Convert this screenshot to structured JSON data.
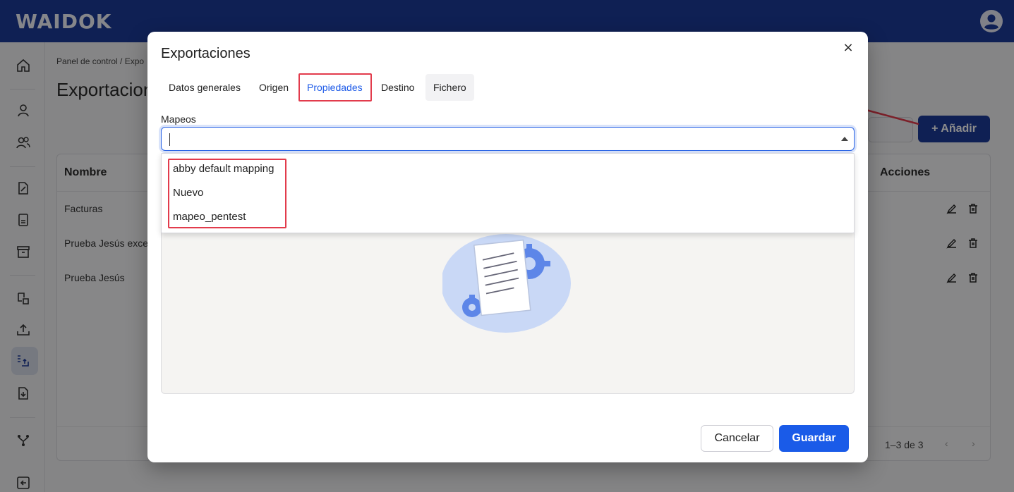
{
  "app": {
    "logo": "WAIDOK"
  },
  "colors": {
    "topbar": "#1d3b9a",
    "accent": "#1e5be8",
    "annotation": "#e23b4c"
  },
  "sidebar": {
    "icons": [
      "home-icon",
      "user-icon",
      "users-icon",
      "document-sign-icon",
      "document-icon",
      "archive-icon",
      "transfer-icon",
      "upload-icon",
      "export-icon",
      "import-icon",
      "workflow-icon",
      "exit-icon"
    ]
  },
  "background_page": {
    "breadcrumb": "Panel de control  /  Expo",
    "title": "Exportacion",
    "add_button": "+ Añadir",
    "table": {
      "headers": [
        "Nombre",
        "Acciones"
      ],
      "rows": [
        "Facturas",
        "Prueba Jesús exce",
        "Prueba Jesús"
      ]
    },
    "pagination": "1–3 de 3"
  },
  "dialog": {
    "title": "Exportaciones",
    "close_label": "×",
    "tabs": [
      "Datos generales",
      "Origen",
      "Propiedades",
      "Destino",
      "Fichero"
    ],
    "active_tab": "Propiedades",
    "field_label": "Mapeos",
    "select_value": "",
    "options": [
      "abby default mapping",
      "Nuevo",
      "mapeo_pentest"
    ],
    "cancel_label": "Cancelar",
    "save_label": "Guardar"
  }
}
